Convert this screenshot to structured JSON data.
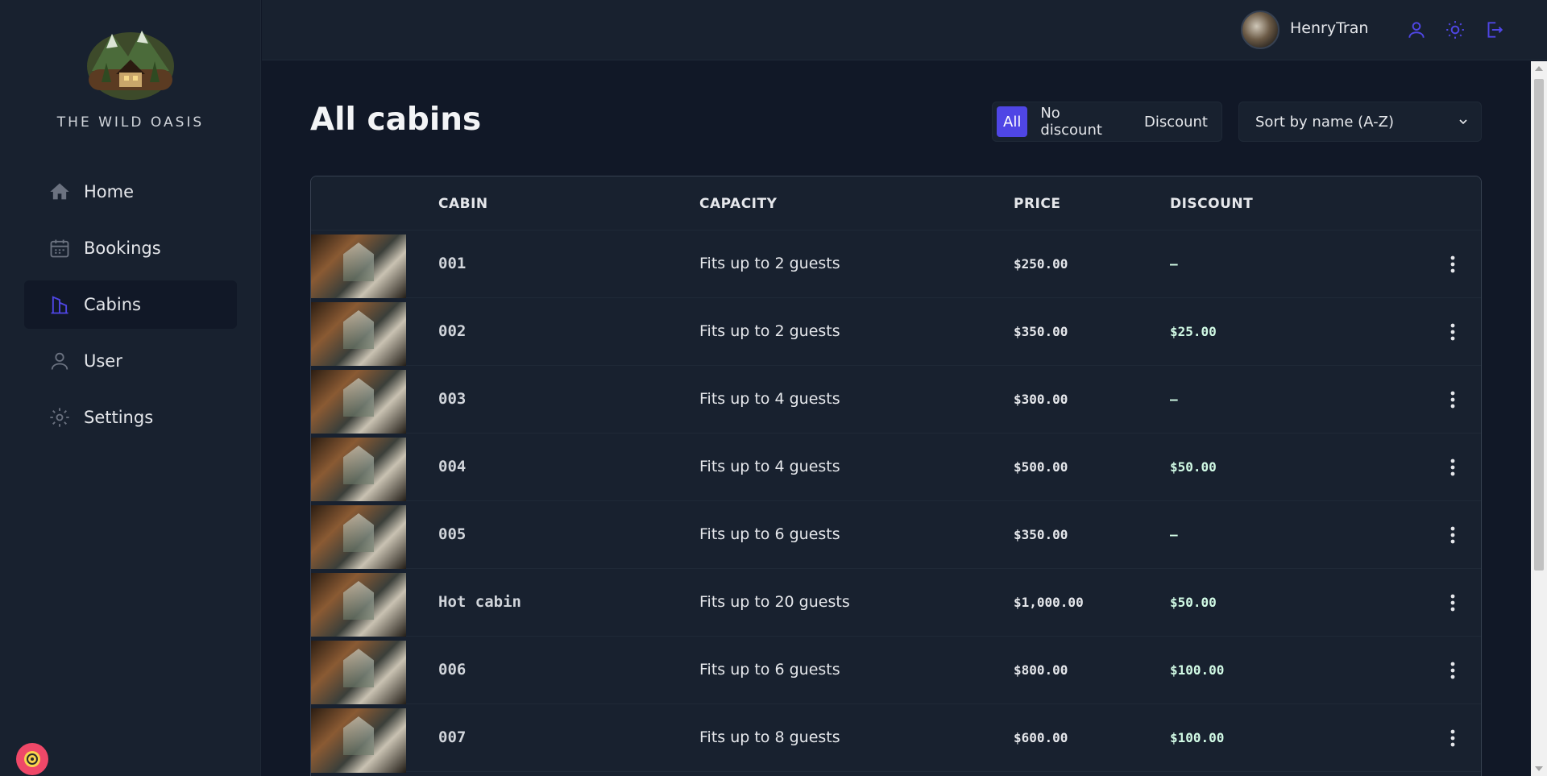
{
  "brand": {
    "name": "THE WILD OASIS"
  },
  "nav": {
    "items": [
      {
        "label": "Home",
        "icon": "home-icon",
        "active": false
      },
      {
        "label": "Bookings",
        "icon": "calendar-icon",
        "active": false
      },
      {
        "label": "Cabins",
        "icon": "building-icon",
        "active": true
      },
      {
        "label": "User",
        "icon": "user-icon",
        "active": false
      },
      {
        "label": "Settings",
        "icon": "gear-icon",
        "active": false
      }
    ]
  },
  "header": {
    "username": "HenryTran",
    "actions": [
      "user-icon",
      "sun-icon",
      "logout-icon"
    ]
  },
  "page": {
    "title": "All cabins"
  },
  "filter": {
    "options": [
      "All",
      "No discount",
      "Discount"
    ],
    "selected": "All"
  },
  "sort": {
    "selected": "Sort by name (A-Z)"
  },
  "table": {
    "headers": [
      "",
      "CABIN",
      "CAPACITY",
      "PRICE",
      "DISCOUNT",
      ""
    ],
    "rows": [
      {
        "name": "001",
        "capacity": "Fits up to 2 guests",
        "price": "$250.00",
        "discount": "—"
      },
      {
        "name": "002",
        "capacity": "Fits up to 2 guests",
        "price": "$350.00",
        "discount": "$25.00"
      },
      {
        "name": "003",
        "capacity": "Fits up to 4 guests",
        "price": "$300.00",
        "discount": "—"
      },
      {
        "name": "004",
        "capacity": "Fits up to 4 guests",
        "price": "$500.00",
        "discount": "$50.00"
      },
      {
        "name": "005",
        "capacity": "Fits up to 6 guests",
        "price": "$350.00",
        "discount": "—"
      },
      {
        "name": "Hot cabin",
        "capacity": "Fits up to 20 guests",
        "price": "$1,000.00",
        "discount": "$50.00"
      },
      {
        "name": "006",
        "capacity": "Fits up to 6 guests",
        "price": "$800.00",
        "discount": "$100.00"
      },
      {
        "name": "007",
        "capacity": "Fits up to 8 guests",
        "price": "$600.00",
        "discount": "$100.00"
      }
    ]
  },
  "colors": {
    "accent": "#4f46e5",
    "sidebar_bg": "#18212f",
    "page_bg": "#111827",
    "discount_text": "#d1fae5"
  }
}
